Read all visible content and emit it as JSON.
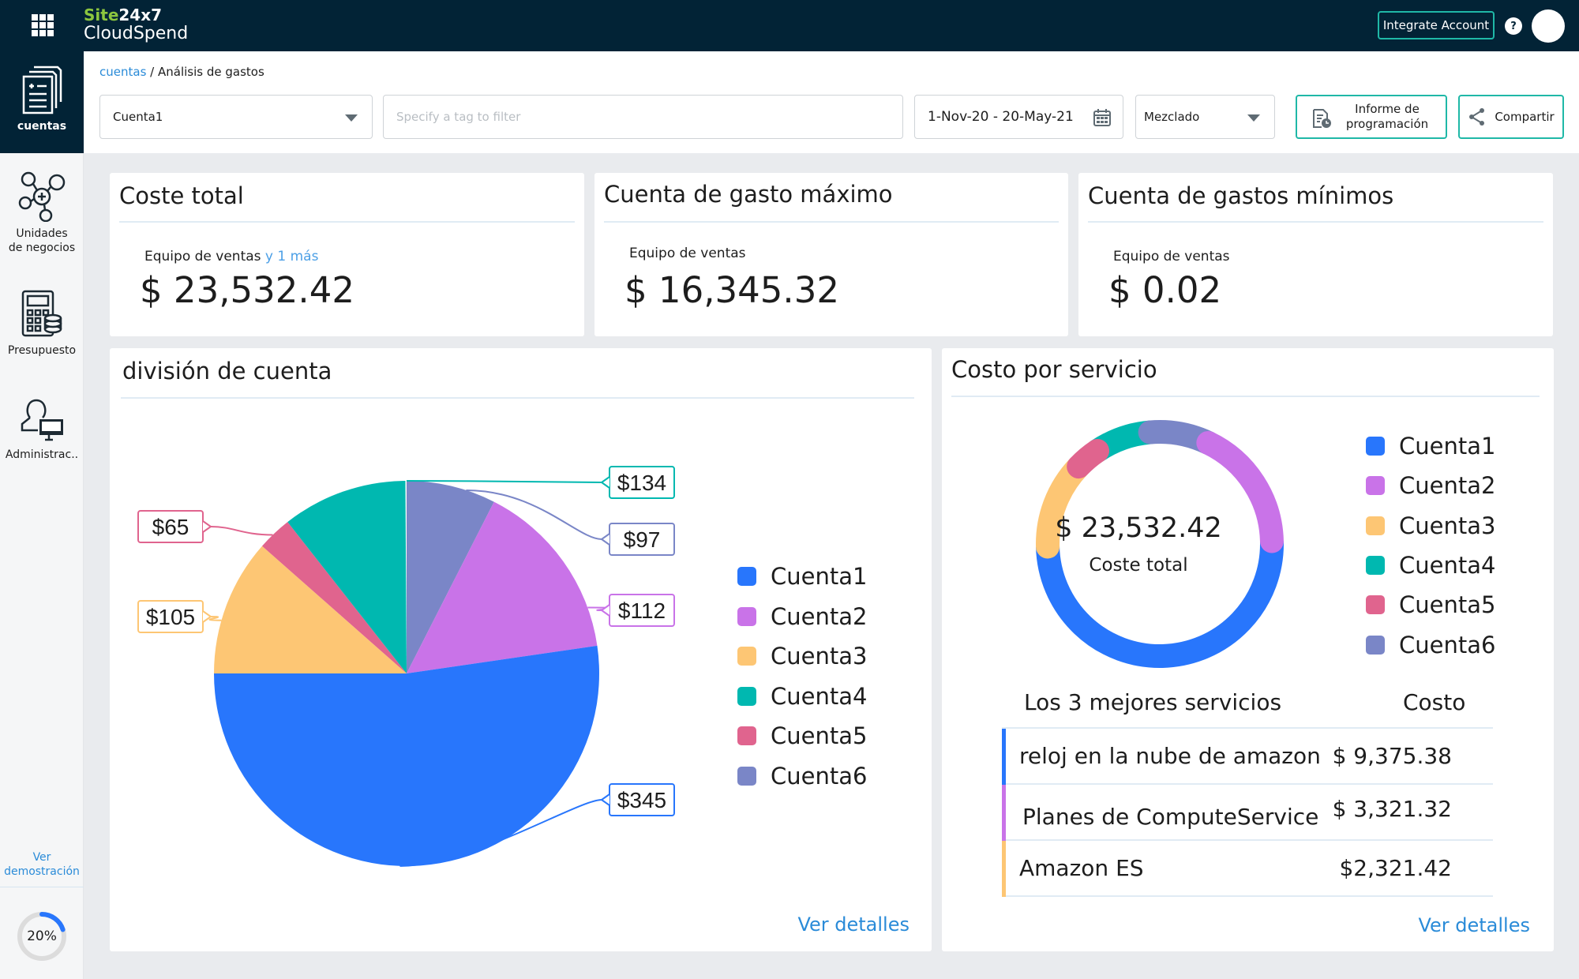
{
  "header": {
    "logo_line1_a": "Site",
    "logo_line1_b": "24x7",
    "logo_line2": "CloudSpend",
    "integrate_label": "Integrate Account",
    "help_label": "?"
  },
  "sidebar": {
    "items": [
      {
        "label": "cuentas",
        "icon": "documents-icon",
        "active": true
      },
      {
        "label_l1": "Unidades",
        "label_l2": "de negocios",
        "icon": "network-icon"
      },
      {
        "label": "Presupuesto",
        "icon": "calculator-icon"
      },
      {
        "label": "Administrac..",
        "icon": "admin-user-icon"
      }
    ],
    "demo_l1": "Ver",
    "demo_l2": "demostración",
    "progress_label": "20%",
    "progress_value": 0.2
  },
  "breadcrumb": {
    "parent": "cuentas",
    "separator": "/",
    "current": "Análisis de gastos"
  },
  "filters": {
    "account_select": "Cuenta1",
    "tag_placeholder": "Specify a tag to filter",
    "date_range": "1-Nov-20 - 20-May-21",
    "mode_select": "Mezclado",
    "schedule_l1": "Informe de",
    "schedule_l2": "programación",
    "share_label": "Compartir"
  },
  "kpis": [
    {
      "title": "Coste total",
      "sub": "Equipo de ventas",
      "more": "y 1 más",
      "value": "$ 23,532.42"
    },
    {
      "title": "Cuenta de gasto máximo",
      "sub": "Equipo de ventas",
      "value": "$ 16,345.32"
    },
    {
      "title": "Cuenta de gastos mínimos",
      "sub": "Equipo de ventas",
      "value": "$ 0.02"
    }
  ],
  "colors": {
    "Cuenta1": "#2876fc",
    "Cuenta2": "#c973e8",
    "Cuenta3": "#fdc674",
    "Cuenta4": "#00b8b0",
    "Cuenta5": "#e0648e",
    "Cuenta6": "#7a86c7"
  },
  "account_split": {
    "title": "división de cuenta",
    "ver_detalles": "Ver detalles"
  },
  "service_cost": {
    "title": "Costo por servicio",
    "center_value": "$ 23,532.42",
    "center_label": "Coste total",
    "table_header_service": "Los 3 mejores servicios",
    "table_header_cost": "Costo",
    "rows": [
      {
        "name": "reloj en la nube de amazon",
        "cost": "$ 9,375.38",
        "color": "#2876fc"
      },
      {
        "name": "Planes de ComputeService",
        "cost": "$ 3,321.32",
        "color": "#c973e8"
      },
      {
        "name": "Amazon ES",
        "cost": "$2,321.42",
        "color": "#fdc674"
      }
    ],
    "ver_detalles": "Ver detalles"
  },
  "chart_data": [
    {
      "type": "pie",
      "title": "división de cuenta",
      "categories": [
        "Cuenta1",
        "Cuenta2",
        "Cuenta3",
        "Cuenta4",
        "Cuenta5",
        "Cuenta6"
      ],
      "values": [
        345,
        112,
        105,
        134,
        65,
        97
      ],
      "data_labels": [
        "$345",
        "$112",
        "$105",
        "$134",
        "$65",
        "$97"
      ],
      "visual_share_percent": [
        52.3,
        15.2,
        11.5,
        10.5,
        2.9,
        7.5
      ],
      "legend": "right"
    },
    {
      "type": "pie",
      "variant": "donut",
      "title": "Costo por servicio",
      "categories": [
        "Cuenta1",
        "Cuenta2",
        "Cuenta3",
        "Cuenta4",
        "Cuenta5",
        "Cuenta6"
      ],
      "visual_share_percent": [
        50,
        17.5,
        12.5,
        8,
        3.5,
        8.5
      ],
      "center_text": "$ 23,532.42",
      "center_subtext": "Coste total",
      "legend": "right"
    }
  ]
}
